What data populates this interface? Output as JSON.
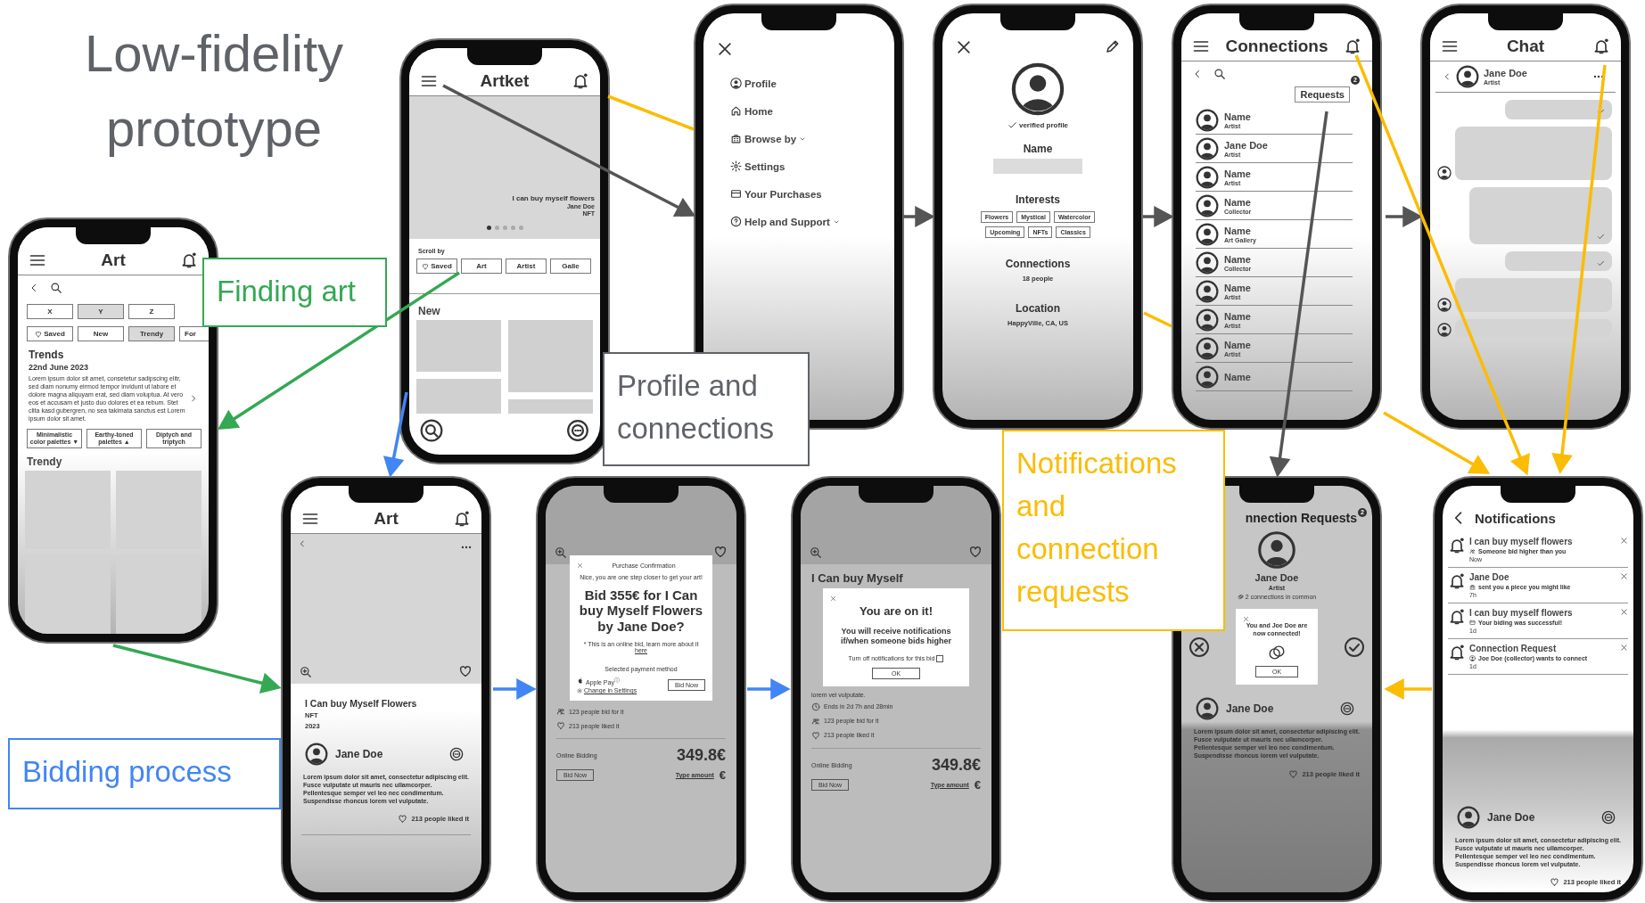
{
  "title": "Low-fidelity prototype",
  "labels": [
    {
      "text": "Finding art",
      "color": "#34a853"
    },
    {
      "text": "Profile and connections",
      "color": "#5f6368"
    },
    {
      "text": "Bidding process",
      "color": "#4285f4"
    },
    {
      "text": "Notifications and connection requests",
      "color": "#fbbc04"
    }
  ],
  "screens": [
    {
      "kind": "browse",
      "title": "Art",
      "filters": [
        {
          "label": "X",
          "selected": false
        },
        {
          "label": "Y",
          "selected": true
        },
        {
          "label": "Z",
          "selected": false
        }
      ],
      "chips": [
        {
          "label": "Saved",
          "selected": false
        },
        {
          "label": "New",
          "selected": false
        },
        {
          "label": "Trendy",
          "selected": true
        },
        {
          "label": "For",
          "selected": false
        }
      ],
      "section": "Trends",
      "date": "22nd June 2023",
      "body": "Lorem ipsum dolor sit amet, consetetur sadipscing elitr, sed diam nonumy eirmod tempor invidunt ut labore et dolore magna aliquyam erat, sed diam voluptua. At vero eos et accusam et justo duo dolores et ea rebum. Stet clita kasd gubergren, no sea takimata sanctus est Lorem ipsum dolor sit amet.",
      "tags": [
        {
          "label": "Minimalistic color palettes",
          "mark": "▼"
        },
        {
          "label": "Earthy-toned palettes",
          "mark": "▲"
        },
        {
          "label": "Diptych and triptych"
        }
      ],
      "grid_title": "Trendy"
    },
    {
      "kind": "home",
      "title": "Artket",
      "banner": {
        "caption": "I can buy myself flowers",
        "artist": "Jane Doe",
        "type": "NFT"
      },
      "pages": [
        {
          "selected": true
        },
        {
          "selected": false
        },
        {
          "selected": false
        },
        {
          "selected": false
        },
        {
          "selected": false
        }
      ],
      "scroll_label": "Scroll by",
      "chips": [
        "Saved",
        "Art",
        "Artist",
        "Galle"
      ],
      "grid_title": "New"
    },
    {
      "kind": "menu",
      "items": [
        {
          "label": "Profile",
          "submenu": false
        },
        {
          "label": "Home",
          "submenu": false
        },
        {
          "label": "Browse by",
          "submenu": true
        },
        {
          "label": "Settings",
          "submenu": false
        },
        {
          "label": "Your Purchases",
          "submenu": false
        },
        {
          "label": "Help and Support",
          "submenu": true
        }
      ]
    },
    {
      "kind": "profile",
      "verified": "verified profile",
      "name_label": "Name",
      "interests_title": "Interests",
      "interests": [
        "Flowers",
        "Mystical",
        "Watercolor",
        "Upcoming",
        "NFTs",
        "Classics"
      ],
      "connections_title": "Connections",
      "connections": "18 people",
      "location_title": "Location",
      "location": "HappyVille, CA, US"
    },
    {
      "kind": "connections",
      "title": "Connections",
      "requests": "Requests",
      "badge": "2",
      "people": [
        {
          "name": "Name",
          "role": "Artist"
        },
        {
          "name": "Jane Doe",
          "role": "Artist"
        },
        {
          "name": "Name",
          "role": "Artist"
        },
        {
          "name": "Name",
          "role": "Collector"
        },
        {
          "name": "Name",
          "role": "Art Gallery"
        },
        {
          "name": "Name",
          "role": "Collector"
        },
        {
          "name": "Name",
          "role": "Artist"
        },
        {
          "name": "Name",
          "role": "Artist"
        },
        {
          "name": "Name",
          "role": "Artist"
        },
        {
          "name": "Name"
        }
      ]
    },
    {
      "kind": "chat",
      "title": "Chat",
      "contact": {
        "name": "Jane Doe",
        "role": "Artist"
      },
      "messages": [
        {
          "kind": "sent",
          "read": true
        },
        {
          "kind": "received",
          "read": false
        },
        {
          "kind": "sent",
          "read": true
        },
        {
          "kind": "sent",
          "read": true
        },
        {
          "kind": "received",
          "read": false
        },
        {
          "kind": "received",
          "read": false
        }
      ]
    },
    {
      "kind": "detail",
      "title": "Art",
      "art_title": "I Can buy Myself Flowers",
      "type": "NFT",
      "year": "2023",
      "artist": "Jane Doe",
      "body": "Lorem ipsum dolor sit amet, consectetur adipiscing elit. Fusce vulputate ut mauris nec ullamcorper. Pellentesque semper vel leo nec condimentum. Suspendisse rhoncus lorem vel vulputate.",
      "likes": "213 people liked it"
    },
    {
      "kind": "purchase",
      "dialog": {
        "title": "Purchase Confirmation",
        "intro": "Nice, you are one step closer to get your art!",
        "question": "Bid 355€ for I Can buy Myself Flowers by Jane Doe?",
        "note": "* This is an online bid, learn more  about it",
        "link": "here",
        "payment_label": "Selected payment method",
        "payment": "Apple Pay$^{ⓘ}$",
        "change": "Change in Settings",
        "button": "Bid Now"
      },
      "bids": "123 people bid for it",
      "likes": "213 people liked it",
      "mode": "Online Bidding",
      "price": "349.8€",
      "bid_button": "Bid Now",
      "amount_label": "Type amount",
      "currency": "€"
    },
    {
      "kind": "confirmed",
      "heading": "I Can buy Myself",
      "dialog": {
        "title": "You are on it!",
        "text": "You will receive notifications if/when someone bids higher",
        "option": "Turn off notifications for this bid",
        "checked": false,
        "button": "OK"
      },
      "body_end": "lorem vel vulputate.",
      "ends": "Ends in 2d 7h and 28min",
      "bids": "123 people bid for it",
      "likes": "213 people liked it",
      "mode": "Online Bidding",
      "price": "349.8€",
      "bid_button": "Bid Now",
      "amount_label": "Type amount",
      "currency": "€"
    },
    {
      "kind": "requests",
      "title": "nnection Requests",
      "badge": "2",
      "name": "Jane Doe",
      "role": "Artist",
      "mutual": "2 connections in common",
      "dialog": {
        "text": "You and Joe Doe are now connected!",
        "button": "OK"
      },
      "artist": "Jane Doe",
      "body": "Lorem ipsum dolor sit amet, consectetur adipiscing elit. Fusce vulputate ut mauris nec ullamcorper. Pellentesque semper vel leo nec condimentum. Suspendisse rhoncus lorem vel vulputate.",
      "likes": "213 people liked it"
    },
    {
      "kind": "notifications",
      "title": "Notifications",
      "items": [
        {
          "title": "I can buy myself flowers",
          "text": "Someone bid higher than you",
          "time": "Now"
        },
        {
          "title": "Jane Doe",
          "text": "sent you a piece you might like",
          "time": "7h"
        },
        {
          "title": "I can buy myself flowers",
          "text": "Your biding was successful!",
          "time": "1d"
        },
        {
          "title": "Connection Request",
          "text": "Joe Doe (collector) wants to connect",
          "time": "1d"
        }
      ],
      "artist": "Jane Doe",
      "body": "Lorem ipsum dolor sit amet, consectetur adipiscing elit. Fusce vulputate ut mauris nec ullamcorper. Pellentesque semper vel leo nec condimentum. Suspendisse rhoncus lorem vel vulputate.",
      "likes": "213 people liked it"
    }
  ]
}
